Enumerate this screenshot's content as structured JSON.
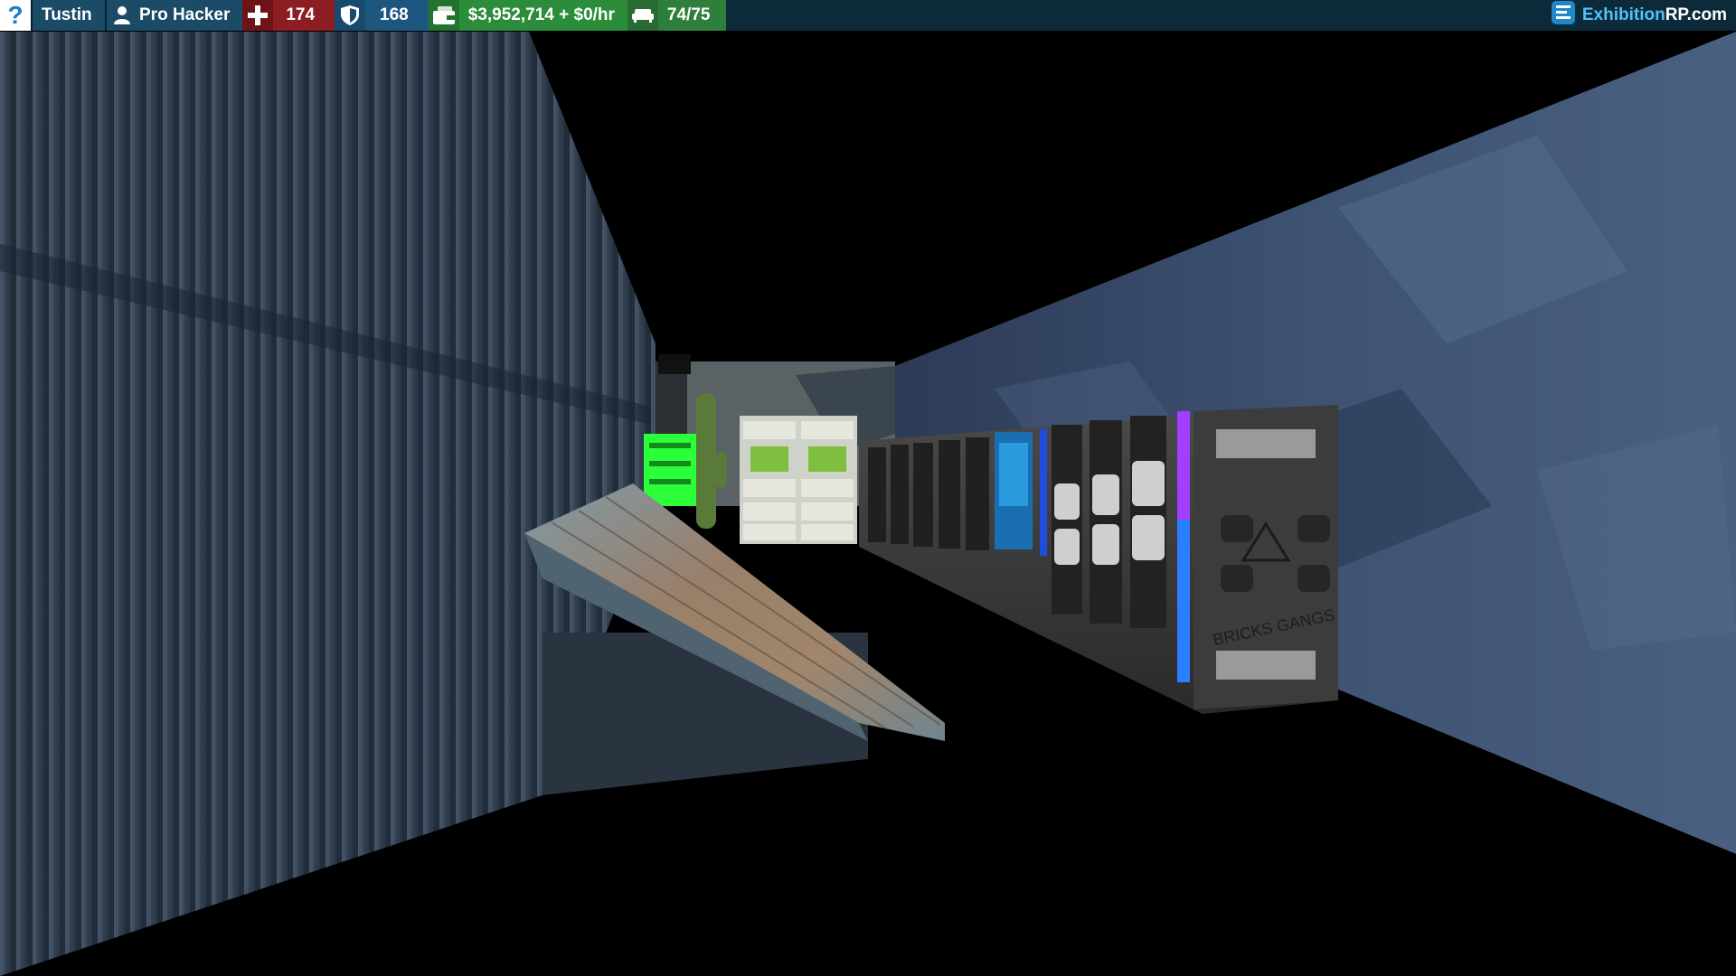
{
  "hud": {
    "help_glyph": "?",
    "player_name": "Tustin",
    "job": "Pro Hacker",
    "health": "174",
    "armor": "168",
    "money": "$3,952,714 + $0/hr",
    "props": "74/75"
  },
  "brand": {
    "part_a": "Exhibition",
    "part_b": "RP.com"
  },
  "scene": {
    "server_label": "BRICKS GANGS"
  },
  "icons": {
    "help": "question-icon",
    "job": "person-icon",
    "health": "health-cross-icon",
    "armor": "shield-icon",
    "money": "wallet-icon",
    "props": "sofa-icon",
    "brand": "exhibition-logo-icon"
  },
  "colors": {
    "hud_bg": "#0d2a3a",
    "health": "#8c1d22",
    "armor": "#1d5780",
    "money": "#2b8c3a",
    "brand_accent": "#4fc3f7"
  }
}
